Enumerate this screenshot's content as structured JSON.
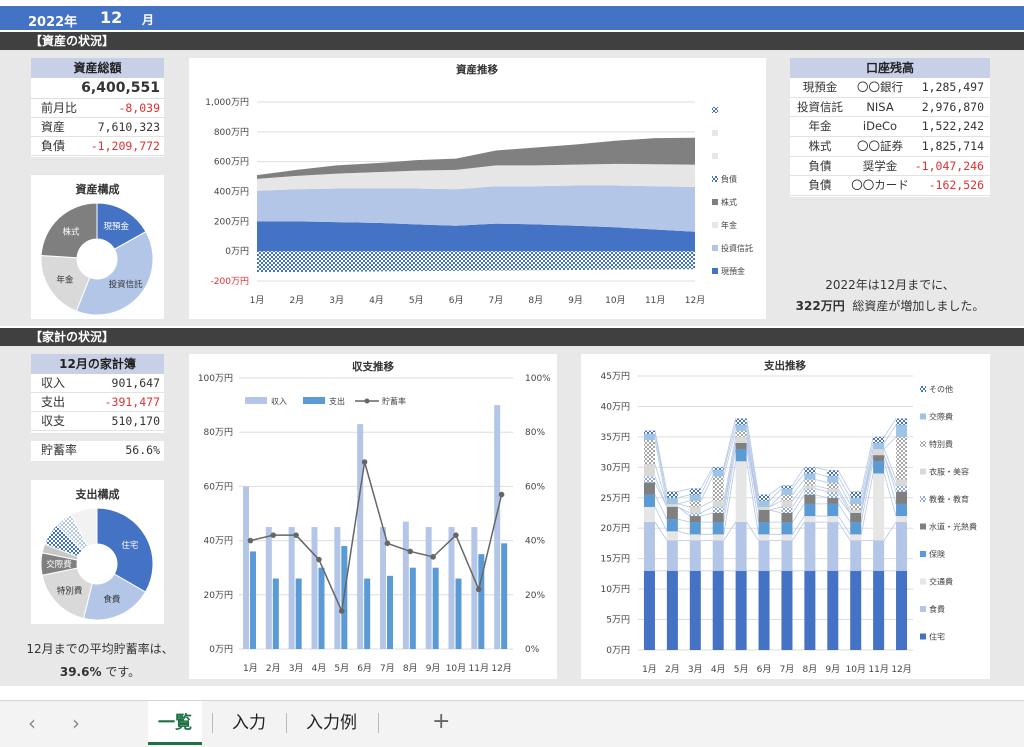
{
  "header": {
    "year": "2022年",
    "month": "12",
    "month_unit": "月"
  },
  "asset_section": {
    "title": "【資産の状況】",
    "total": {
      "title": "資産総額",
      "value": "6,400,551",
      "rows": [
        {
          "label": "前月比",
          "value": "-8,039",
          "negative": true
        },
        {
          "label": "資産",
          "value": "7,610,323",
          "negative": false
        },
        {
          "label": "負債",
          "value": "-1,209,772",
          "negative": true
        }
      ]
    },
    "composition": {
      "title": "資産構成",
      "slices": [
        {
          "label": "現預金",
          "value": 1285497,
          "color": "#4472c4"
        },
        {
          "label": "投資信託",
          "value": 2976870,
          "color": "#b4c6e7"
        },
        {
          "label": "年金",
          "value": 1522242,
          "color": "#d9d9d9"
        },
        {
          "label": "株式",
          "value": 1825714,
          "color": "#7f7f7f"
        }
      ]
    },
    "accounts": {
      "title": "口座残高",
      "rows": [
        {
          "type": "現預金",
          "name": "〇〇銀行",
          "value": "1,285,497",
          "negative": false
        },
        {
          "type": "投資信託",
          "name": "NISA",
          "value": "2,976,870",
          "negative": false
        },
        {
          "type": "年金",
          "name": "iDeCo",
          "value": "1,522,242",
          "negative": false
        },
        {
          "type": "株式",
          "name": "〇〇証券",
          "value": "1,825,714",
          "negative": false
        },
        {
          "type": "負債",
          "name": "奨学金",
          "value": "-1,047,246",
          "negative": true
        },
        {
          "type": "負債",
          "name": "〇〇カード",
          "value": "-162,526",
          "negative": true
        }
      ]
    },
    "note": {
      "line1": "2022年は12月までに、",
      "amount": "322万円",
      "line2": "総資産が増加しました。"
    }
  },
  "household_section": {
    "title": "【家計の状況】",
    "ledger": {
      "title": "12月の家計簿",
      "rows": [
        {
          "label": "収入",
          "value": "901,647",
          "negative": false
        },
        {
          "label": "支出",
          "value": "-391,477",
          "negative": true
        },
        {
          "label": "収支",
          "value": "510,170",
          "negative": false
        }
      ],
      "rate_label": "貯蓄率",
      "rate_value": "56.6%"
    },
    "expense_comp": {
      "title": "支出構成",
      "slices": [
        {
          "label": "住宅",
          "value": 13,
          "color": "#4472c4",
          "pattern": false
        },
        {
          "label": "食費",
          "value": 8,
          "color": "#b4c6e7",
          "pattern": false
        },
        {
          "label": "特別費",
          "value": 7,
          "color": "#d9d9d9",
          "pattern": false
        },
        {
          "label": "交際費",
          "value": 2.5,
          "color": "#808080",
          "pattern": false
        },
        {
          "label": "",
          "value": 1,
          "color": "#c8c8c8",
          "pattern": false
        },
        {
          "label": "",
          "value": 2.5,
          "color": "#4472c4",
          "pattern": true
        },
        {
          "label": "",
          "value": 2,
          "color": "#b4c6e7",
          "pattern": true
        },
        {
          "label": "",
          "value": 3,
          "color": "#f2f2f2",
          "pattern": false
        }
      ]
    },
    "note": {
      "line1": "12月までの平均貯蓄率は、",
      "amount": "39.6%",
      "line2": "です。"
    }
  },
  "chart_data": [
    {
      "type": "area",
      "title": "資産推移",
      "x": [
        "1月",
        "2月",
        "3月",
        "4月",
        "5月",
        "6月",
        "7月",
        "8月",
        "9月",
        "10月",
        "11月",
        "12月"
      ],
      "ylim": [
        -200,
        1000
      ],
      "yticks": [
        "-200万円",
        "0万円",
        "200万円",
        "400万円",
        "600万円",
        "800万円",
        "1,000万円"
      ],
      "series": [
        {
          "name": "現預金",
          "color": "#4472c4",
          "values": [
            200,
            200,
            195,
            190,
            180,
            170,
            185,
            180,
            170,
            160,
            145,
            130
          ]
        },
        {
          "name": "投資信託",
          "color": "#b4c6e7",
          "values": [
            205,
            215,
            225,
            230,
            240,
            245,
            250,
            255,
            270,
            280,
            290,
            300
          ]
        },
        {
          "name": "年金",
          "color": "#e7e6e6",
          "values": [
            80,
            90,
            100,
            110,
            120,
            130,
            140,
            140,
            140,
            145,
            148,
            150
          ]
        },
        {
          "name": "株式",
          "color": "#808080",
          "values": [
            25,
            40,
            55,
            60,
            70,
            75,
            100,
            120,
            135,
            155,
            175,
            180
          ]
        },
        {
          "name": "負債",
          "color": "#4472c4",
          "pattern": true,
          "values": [
            -140,
            -140,
            -138,
            -136,
            -134,
            -132,
            -130,
            -128,
            -126,
            -124,
            -122,
            -121
          ]
        }
      ]
    },
    {
      "type": "bar",
      "title": "収支推移",
      "x": [
        "1月",
        "2月",
        "3月",
        "4月",
        "5月",
        "6月",
        "7月",
        "8月",
        "9月",
        "10月",
        "11月",
        "12月"
      ],
      "ylim": [
        0,
        100
      ],
      "yticks": [
        "0万円",
        "20万円",
        "40万円",
        "60万円",
        "80万円",
        "100万円"
      ],
      "y2lim": [
        0,
        100
      ],
      "y2ticks": [
        "0%",
        "20%",
        "40%",
        "60%",
        "80%",
        "100%"
      ],
      "series": [
        {
          "name": "収入",
          "color": "#b4c6e7",
          "values": [
            60,
            45,
            45,
            45,
            45,
            83,
            45,
            47,
            45,
            45,
            45,
            90
          ]
        },
        {
          "name": "支出",
          "color": "#5b9bd5",
          "values": [
            36,
            26,
            26,
            30,
            38,
            26,
            27,
            30,
            30,
            26,
            35,
            39
          ]
        },
        {
          "name": "貯蓄率",
          "type": "line",
          "color": "#666666",
          "values": [
            40,
            42,
            42,
            33,
            14,
            69,
            39,
            36,
            34,
            42,
            22,
            57
          ]
        }
      ]
    },
    {
      "type": "bar",
      "stacked": true,
      "title": "支出推移",
      "x": [
        "1月",
        "2月",
        "3月",
        "4月",
        "5月",
        "6月",
        "7月",
        "8月",
        "9月",
        "10月",
        "11月",
        "12月"
      ],
      "ylim": [
        0,
        45
      ],
      "yticks": [
        "0万円",
        "5万円",
        "10万円",
        "15万円",
        "20万円",
        "25万円",
        "30万円",
        "35万円",
        "40万円",
        "45万円"
      ],
      "series": [
        {
          "name": "住宅",
          "color": "#4472c4",
          "pattern": false,
          "values": [
            13,
            13,
            13,
            13,
            13,
            13,
            13,
            13,
            13,
            13,
            13,
            13
          ]
        },
        {
          "name": "食費",
          "color": "#b4c6e7",
          "pattern": false,
          "values": [
            8,
            5,
            5,
            5,
            8,
            5,
            5,
            8,
            8,
            5,
            5,
            8
          ]
        },
        {
          "name": "交通費",
          "color": "#e7e6e6",
          "pattern": false,
          "values": [
            2.5,
            1.5,
            1,
            1,
            10,
            1,
            1,
            1,
            1,
            1,
            11,
            1
          ]
        },
        {
          "name": "保険",
          "color": "#5b9bd5",
          "pattern": false,
          "values": [
            2,
            2,
            2,
            2,
            2,
            2,
            2,
            2,
            2,
            2,
            2,
            2
          ]
        },
        {
          "name": "水道・光熱費",
          "color": "#808080",
          "pattern": false,
          "values": [
            2,
            2,
            1,
            1.5,
            1,
            2,
            1.5,
            1.5,
            1,
            1.5,
            1,
            2
          ]
        },
        {
          "name": "教養・教育",
          "color": "#8faadc",
          "pattern": true,
          "values": [
            1,
            0,
            0.5,
            1,
            0,
            0,
            1,
            1,
            1,
            0,
            0,
            1
          ]
        },
        {
          "name": "衣服・美容",
          "color": "#d9d9d9",
          "pattern": false,
          "values": [
            2,
            0.5,
            1,
            1,
            1,
            0.5,
            1,
            0.5,
            0.5,
            0.5,
            1,
            1
          ]
        },
        {
          "name": "特別費",
          "color": "#a6a6a6",
          "pattern": true,
          "values": [
            4,
            0,
            1,
            4,
            1,
            0,
            1,
            1,
            1,
            1,
            0,
            7
          ]
        },
        {
          "name": "交際費",
          "color": "#9dc3e6",
          "pattern": false,
          "values": [
            1,
            1,
            1,
            1,
            1,
            1,
            1,
            1,
            1,
            1,
            1,
            2
          ]
        },
        {
          "name": "その他",
          "color": "#4472c4",
          "pattern": true,
          "values": [
            0.5,
            1,
            1,
            0.5,
            1,
            1,
            0.5,
            1,
            1,
            1,
            1,
            1
          ]
        }
      ]
    }
  ],
  "tabs": {
    "items": [
      "一覧",
      "入力",
      "入力例"
    ],
    "active": 0,
    "prev_icon": "‹",
    "next_icon": "›",
    "add_icon": "+"
  }
}
